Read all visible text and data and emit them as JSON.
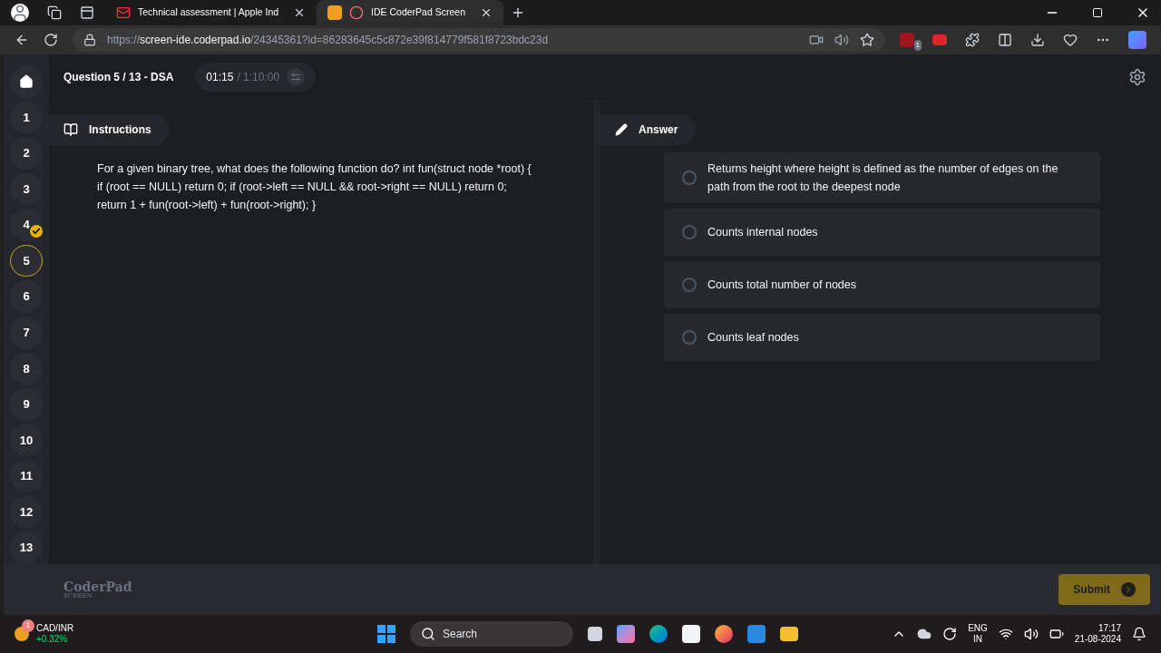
{
  "browser": {
    "tabs": [
      {
        "title": "Technical assessment | Apple Ind",
        "kind": "mail",
        "selected": false
      },
      {
        "title": "IDE CoderPad Screen",
        "kind": "record",
        "selected": true
      }
    ],
    "url": {
      "scheme": "https://",
      "host": "screen-ide.coderpad.io",
      "path": "/24345361?id=86283645c5c872e39f814779f581f8723bdc23d"
    },
    "extension_badge": "1"
  },
  "questions": [
    {
      "label": "1",
      "selected": false,
      "answered": false
    },
    {
      "label": "2",
      "selected": false,
      "answered": false
    },
    {
      "label": "3",
      "selected": false,
      "answered": false
    },
    {
      "label": "4",
      "selected": false,
      "answered": true
    },
    {
      "label": "5",
      "selected": true,
      "answered": false
    },
    {
      "label": "6",
      "selected": false,
      "answered": false
    },
    {
      "label": "7",
      "selected": false,
      "answered": false
    },
    {
      "label": "8",
      "selected": false,
      "answered": false
    },
    {
      "label": "9",
      "selected": false,
      "answered": false
    },
    {
      "label": "10",
      "selected": false,
      "answered": false
    },
    {
      "label": "11",
      "selected": false,
      "answered": false
    },
    {
      "label": "12",
      "selected": false,
      "answered": false
    },
    {
      "label": "13",
      "selected": false,
      "answered": false
    }
  ],
  "header": {
    "title": "Question 5 / 13 - DSA",
    "elapsed": "01:15",
    "total": "/ 1:10:00"
  },
  "instructions": {
    "tab": "Instructions",
    "text": "For a given binary tree, what does the following function do? int fun(struct node *root) { if (root == NULL) return 0; if (root->left == NULL && root->right == NULL) return 0; return 1 + fun(root->left) + fun(root->right); }"
  },
  "answer": {
    "tab": "Answer",
    "options": [
      {
        "text": "Returns height where height is defined as the number of edges on the path from the root to the deepest node",
        "selected": false
      },
      {
        "text": "Counts internal nodes",
        "selected": false
      },
      {
        "text": "Counts total number of nodes",
        "selected": false
      },
      {
        "text": "Counts leaf nodes",
        "selected": false
      }
    ]
  },
  "footer": {
    "logo": "CoderPad",
    "logo_sub": "SCREEN",
    "submit": "Submit"
  },
  "taskbar": {
    "widget": {
      "badge": "1",
      "title": "CAD/INR",
      "change": "+0.32%"
    },
    "search": "Search",
    "lang": "ENG",
    "region": "IN",
    "time": "17:17",
    "date": "21-08-2024"
  }
}
